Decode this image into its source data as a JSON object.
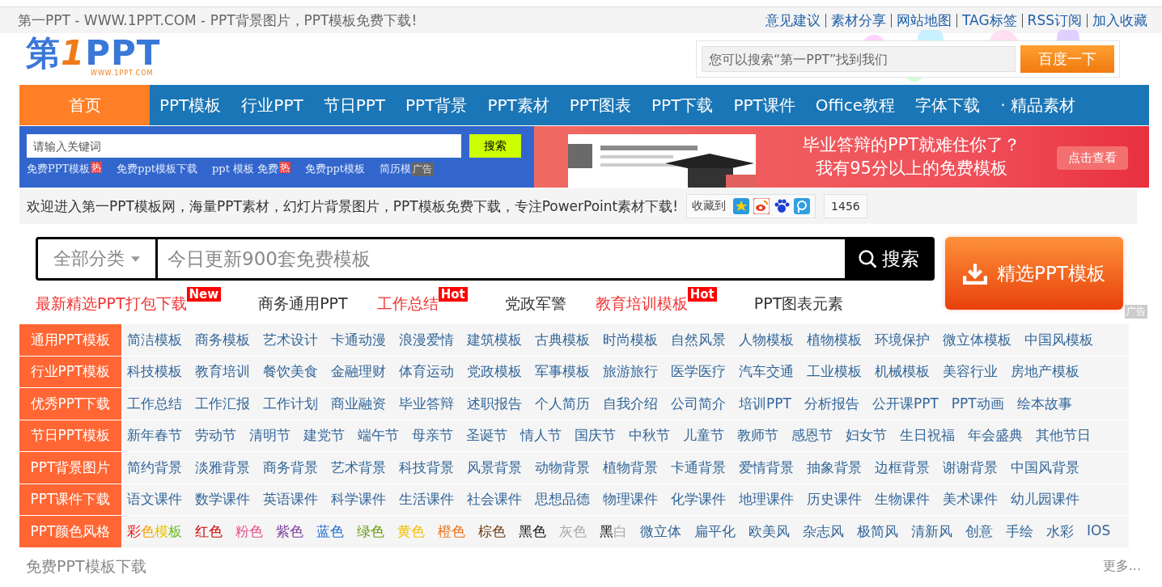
{
  "top_bar": {
    "title": "第一PPT - WWW.1PPT.COM - PPT背景图片，PPT模板免费下载!",
    "links": [
      "意见建议",
      "素材分享",
      "网站地图",
      "TAG标签",
      "RSS订阅",
      "加入收藏"
    ]
  },
  "header": {
    "logo": {
      "part_1": "第",
      "part_2": "1",
      "part_3": "PPT",
      "url": "WWW.1PPT.COM"
    },
    "search": {
      "placeholder": "您可以搜索“第一PPT”找到我们",
      "button": "百度一下"
    }
  },
  "nav": [
    {
      "label": "首页",
      "selected": true
    },
    {
      "label": "PPT模板",
      "selected": false
    },
    {
      "label": "行业PPT",
      "selected": false
    },
    {
      "label": "节日PPT",
      "selected": false
    },
    {
      "label": "PPT背景",
      "selected": false
    },
    {
      "label": "PPT素材",
      "selected": false
    },
    {
      "label": "PPT图表",
      "selected": false
    },
    {
      "label": "PPT下载",
      "selected": false
    },
    {
      "label": "PPT课件",
      "selected": false
    },
    {
      "label": "Office教程",
      "selected": false
    },
    {
      "label": "字体下载",
      "selected": false
    },
    {
      "label": "· 精品素材",
      "selected": false
    }
  ],
  "quick_search": {
    "placeholder": "请输入关键词",
    "button": "搜索",
    "tags": [
      {
        "label": "免费PPT模板",
        "badge": "热"
      },
      {
        "label": "免费ppt模板下载"
      },
      {
        "label": "ppt 模板 免费",
        "badge": "热"
      },
      {
        "label": "免费ppt模板"
      },
      {
        "label": "简历模"
      }
    ],
    "ad_label": "广告"
  },
  "banner": {
    "line_1": "毕业答辩的PPT就难住你了？",
    "line_2": "我有95分以上的免费模板",
    "button": "点击查看"
  },
  "welcome": {
    "text": "欢迎进入第一PPT模板网，海量PPT素材，幻灯片背景图片，PPT模板免费下载，专注PowerPoint素材下载!",
    "bookmark_label": "收藏到",
    "count": "1456"
  },
  "main_search": {
    "category": "全部分类",
    "placeholder": "今日更新900套免费模板",
    "button": "搜索",
    "promo_button": "精选PPT模板",
    "ad_label": "广告",
    "hot_links": [
      {
        "label": "最新精选PPT打包下载",
        "highlight": true,
        "badge": "New"
      },
      {
        "label": "商务通用PPT",
        "highlight": false
      },
      {
        "label": "工作总结",
        "highlight": true,
        "badge": "Hot"
      },
      {
        "label": "党政军警",
        "highlight": false
      },
      {
        "label": "教育培训模板",
        "highlight": true,
        "badge": "Hot"
      },
      {
        "label": "PPT图表元素",
        "highlight": false
      }
    ]
  },
  "categories": [
    {
      "heading": "通用PPT模板",
      "links": [
        "简洁模板",
        "商务模板",
        "艺术设计",
        "卡通动漫",
        "浪漫爱情",
        "建筑模板",
        "古典模板",
        "时尚模板",
        "自然风景",
        "人物模板",
        "植物模板",
        "环境保护",
        "微立体模板",
        "中国风模板"
      ]
    },
    {
      "heading": "行业PPT模板",
      "links": [
        "科技模板",
        "教育培训",
        "餐饮美食",
        "金融理财",
        "体育运动",
        "党政模板",
        "军事模板",
        "旅游旅行",
        "医学医疗",
        "汽车交通",
        "工业模板",
        "机械模板",
        "美容行业",
        "房地产模板"
      ]
    },
    {
      "heading": "优秀PPT下载",
      "links": [
        "工作总结",
        "工作汇报",
        "工作计划",
        "商业融资",
        "毕业答辩",
        "述职报告",
        "个人简历",
        "自我介绍",
        "公司简介",
        "培训PPT",
        "分析报告",
        "公开课PPT",
        "PPT动画",
        "绘本故事"
      ]
    },
    {
      "heading": "节日PPT模板",
      "links": [
        "新年春节",
        "劳动节",
        "清明节",
        "建党节",
        "端午节",
        "母亲节",
        "圣诞节",
        "情人节",
        "国庆节",
        "中秋节",
        "儿童节",
        "教师节",
        "感恩节",
        "妇女节",
        "生日祝福",
        "年会盛典",
        "其他节日"
      ]
    },
    {
      "heading": "PPT背景图片",
      "links": [
        "简约背景",
        "淡雅背景",
        "商务背景",
        "艺术背景",
        "科技背景",
        "风景背景",
        "动物背景",
        "植物背景",
        "卡通背景",
        "爱情背景",
        "抽象背景",
        "边框背景",
        "谢谢背景",
        "中国风背景"
      ]
    },
    {
      "heading": "PPT课件下载",
      "links": [
        "语文课件",
        "数学课件",
        "英语课件",
        "科学课件",
        "生活课件",
        "社会课件",
        "思想品德",
        "物理课件",
        "化学课件",
        "地理课件",
        "历史课件",
        "生物课件",
        "美术课件",
        "幼儿园课件"
      ]
    },
    {
      "heading": "PPT颜色风格",
      "links": [
        {
          "label": "彩色模板",
          "kind": "rainbow"
        },
        {
          "label": "红色",
          "color": "#cc0000"
        },
        {
          "label": "粉色",
          "color": "#e0508a"
        },
        {
          "label": "紫色",
          "color": "#7a3a9a"
        },
        {
          "label": "蓝色",
          "color": "#1a6ad0"
        },
        {
          "label": "绿色",
          "color": "#6a9a10"
        },
        {
          "label": "黄色",
          "color": "#f0c000"
        },
        {
          "label": "橙色",
          "color": "#f07010"
        },
        {
          "label": "棕色",
          "color": "#6a3a10"
        },
        {
          "label": "黑色",
          "color": "#111111"
        },
        {
          "label": "灰色",
          "color": "#aaaaaa"
        },
        {
          "label": "黑白",
          "kind": "two_tone"
        },
        "微立体",
        "扁平化",
        "欧美风",
        "杂志风",
        "极简风",
        "清新风",
        "创意",
        "手绘",
        "水彩",
        "IOS"
      ]
    }
  ],
  "footer": {
    "title": "免费PPT模板下载",
    "more": "更多..."
  }
}
